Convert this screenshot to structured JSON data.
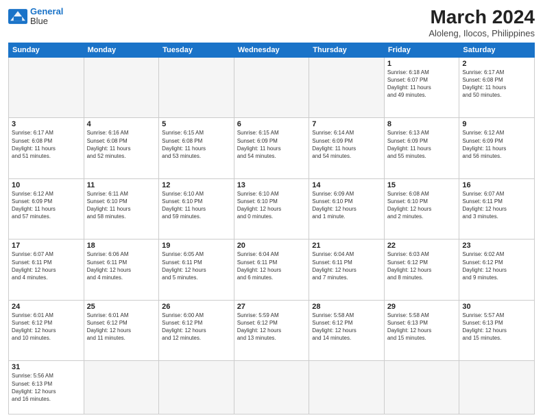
{
  "header": {
    "logo_line1": "General",
    "logo_line2": "Blue",
    "month_title": "March 2024",
    "subtitle": "Aloleng, Ilocos, Philippines"
  },
  "weekdays": [
    "Sunday",
    "Monday",
    "Tuesday",
    "Wednesday",
    "Thursday",
    "Friday",
    "Saturday"
  ],
  "weeks": [
    [
      {
        "day": "",
        "info": ""
      },
      {
        "day": "",
        "info": ""
      },
      {
        "day": "",
        "info": ""
      },
      {
        "day": "",
        "info": ""
      },
      {
        "day": "",
        "info": ""
      },
      {
        "day": "1",
        "info": "Sunrise: 6:18 AM\nSunset: 6:07 PM\nDaylight: 11 hours\nand 49 minutes."
      },
      {
        "day": "2",
        "info": "Sunrise: 6:17 AM\nSunset: 6:08 PM\nDaylight: 11 hours\nand 50 minutes."
      }
    ],
    [
      {
        "day": "3",
        "info": "Sunrise: 6:17 AM\nSunset: 6:08 PM\nDaylight: 11 hours\nand 51 minutes."
      },
      {
        "day": "4",
        "info": "Sunrise: 6:16 AM\nSunset: 6:08 PM\nDaylight: 11 hours\nand 52 minutes."
      },
      {
        "day": "5",
        "info": "Sunrise: 6:15 AM\nSunset: 6:08 PM\nDaylight: 11 hours\nand 53 minutes."
      },
      {
        "day": "6",
        "info": "Sunrise: 6:15 AM\nSunset: 6:09 PM\nDaylight: 11 hours\nand 54 minutes."
      },
      {
        "day": "7",
        "info": "Sunrise: 6:14 AM\nSunset: 6:09 PM\nDaylight: 11 hours\nand 54 minutes."
      },
      {
        "day": "8",
        "info": "Sunrise: 6:13 AM\nSunset: 6:09 PM\nDaylight: 11 hours\nand 55 minutes."
      },
      {
        "day": "9",
        "info": "Sunrise: 6:12 AM\nSunset: 6:09 PM\nDaylight: 11 hours\nand 56 minutes."
      }
    ],
    [
      {
        "day": "10",
        "info": "Sunrise: 6:12 AM\nSunset: 6:09 PM\nDaylight: 11 hours\nand 57 minutes."
      },
      {
        "day": "11",
        "info": "Sunrise: 6:11 AM\nSunset: 6:10 PM\nDaylight: 11 hours\nand 58 minutes."
      },
      {
        "day": "12",
        "info": "Sunrise: 6:10 AM\nSunset: 6:10 PM\nDaylight: 11 hours\nand 59 minutes."
      },
      {
        "day": "13",
        "info": "Sunrise: 6:10 AM\nSunset: 6:10 PM\nDaylight: 12 hours\nand 0 minutes."
      },
      {
        "day": "14",
        "info": "Sunrise: 6:09 AM\nSunset: 6:10 PM\nDaylight: 12 hours\nand 1 minute."
      },
      {
        "day": "15",
        "info": "Sunrise: 6:08 AM\nSunset: 6:10 PM\nDaylight: 12 hours\nand 2 minutes."
      },
      {
        "day": "16",
        "info": "Sunrise: 6:07 AM\nSunset: 6:11 PM\nDaylight: 12 hours\nand 3 minutes."
      }
    ],
    [
      {
        "day": "17",
        "info": "Sunrise: 6:07 AM\nSunset: 6:11 PM\nDaylight: 12 hours\nand 4 minutes."
      },
      {
        "day": "18",
        "info": "Sunrise: 6:06 AM\nSunset: 6:11 PM\nDaylight: 12 hours\nand 4 minutes."
      },
      {
        "day": "19",
        "info": "Sunrise: 6:05 AM\nSunset: 6:11 PM\nDaylight: 12 hours\nand 5 minutes."
      },
      {
        "day": "20",
        "info": "Sunrise: 6:04 AM\nSunset: 6:11 PM\nDaylight: 12 hours\nand 6 minutes."
      },
      {
        "day": "21",
        "info": "Sunrise: 6:04 AM\nSunset: 6:11 PM\nDaylight: 12 hours\nand 7 minutes."
      },
      {
        "day": "22",
        "info": "Sunrise: 6:03 AM\nSunset: 6:12 PM\nDaylight: 12 hours\nand 8 minutes."
      },
      {
        "day": "23",
        "info": "Sunrise: 6:02 AM\nSunset: 6:12 PM\nDaylight: 12 hours\nand 9 minutes."
      }
    ],
    [
      {
        "day": "24",
        "info": "Sunrise: 6:01 AM\nSunset: 6:12 PM\nDaylight: 12 hours\nand 10 minutes."
      },
      {
        "day": "25",
        "info": "Sunrise: 6:01 AM\nSunset: 6:12 PM\nDaylight: 12 hours\nand 11 minutes."
      },
      {
        "day": "26",
        "info": "Sunrise: 6:00 AM\nSunset: 6:12 PM\nDaylight: 12 hours\nand 12 minutes."
      },
      {
        "day": "27",
        "info": "Sunrise: 5:59 AM\nSunset: 6:12 PM\nDaylight: 12 hours\nand 13 minutes."
      },
      {
        "day": "28",
        "info": "Sunrise: 5:58 AM\nSunset: 6:12 PM\nDaylight: 12 hours\nand 14 minutes."
      },
      {
        "day": "29",
        "info": "Sunrise: 5:58 AM\nSunset: 6:13 PM\nDaylight: 12 hours\nand 15 minutes."
      },
      {
        "day": "30",
        "info": "Sunrise: 5:57 AM\nSunset: 6:13 PM\nDaylight: 12 hours\nand 15 minutes."
      }
    ],
    [
      {
        "day": "31",
        "info": "Sunrise: 5:56 AM\nSunset: 6:13 PM\nDaylight: 12 hours\nand 16 minutes."
      },
      {
        "day": "",
        "info": ""
      },
      {
        "day": "",
        "info": ""
      },
      {
        "day": "",
        "info": ""
      },
      {
        "day": "",
        "info": ""
      },
      {
        "day": "",
        "info": ""
      },
      {
        "day": "",
        "info": ""
      }
    ]
  ]
}
